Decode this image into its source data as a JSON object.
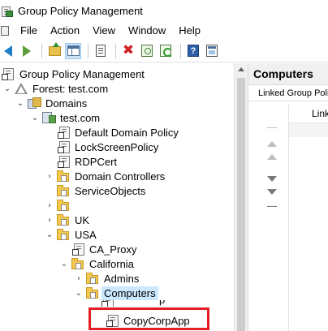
{
  "window": {
    "title": "Group Policy Management"
  },
  "menu": {
    "items": [
      "File",
      "Action",
      "View",
      "Window",
      "Help"
    ]
  },
  "toolbar": {
    "buttons": [
      "back-icon",
      "forward-icon",
      "up-folder-icon",
      "show-hide-tree-icon",
      "export-list-icon",
      "delete-icon",
      "properties-icon",
      "refresh-icon",
      "help-icon",
      "mmc-icon"
    ]
  },
  "tree": {
    "root": "Group Policy Management",
    "forest": "Forest: test.com",
    "domains": "Domains",
    "domain": "test.com",
    "items": {
      "default_domain_policy": "Default Domain Policy",
      "lockscreen_policy": "LockScreenPolicy",
      "rdpcert": "RDPCert",
      "domain_controllers": "Domain Controllers",
      "service_objects": "ServiceObjects",
      "blank1": "",
      "uk": "UK",
      "usa": "USA",
      "ca_proxy": "CA_Proxy",
      "california": "California",
      "admins": "Admins",
      "computers": "Computers",
      "copycorpapp_ghost": "p",
      "copycorpapp": "CopyCorpApp"
    }
  },
  "right_pane": {
    "title": "Computers",
    "tab": "Linked Group Polic",
    "column_link": "Link"
  },
  "colors": {
    "highlight": "#e41e25",
    "selection": "#cce8ff",
    "folder": "#f3c84f"
  }
}
